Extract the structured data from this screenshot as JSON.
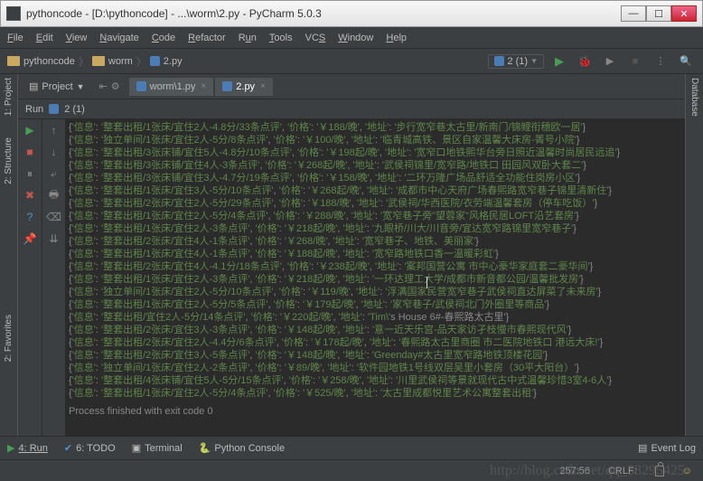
{
  "window": {
    "title": "pythoncode - [D:\\pythoncode] - ...\\worm\\2.py - PyCharm 5.0.3"
  },
  "menu": {
    "file": "File",
    "edit": "Edit",
    "view": "View",
    "navigate": "Navigate",
    "code": "Code",
    "refactor": "Refactor",
    "run": "Run",
    "tools": "Tools",
    "vcs": "VCS",
    "window": "Window",
    "help": "Help"
  },
  "breadcrumb": {
    "project": "pythoncode",
    "folder": "worm",
    "file": "2.py"
  },
  "config": {
    "label": "2 (1)"
  },
  "left_tabs": {
    "project": "1: Project",
    "structure": "2: Structure",
    "favorites": "2: Favorites"
  },
  "right_tabs": {
    "database": "Database"
  },
  "project_btn": "Project",
  "editor_tabs": [
    {
      "label": "worm\\1.py",
      "active": false
    },
    {
      "label": "2.py",
      "active": true
    }
  ],
  "run_header": "Run",
  "run_config": "2 (1)",
  "console_lines": [
    "{'信息': '整套出租/1张床/宜住2人-4.8分/33条点评', '价格': '￥188/晚', '地址': '步行宽窄巷太古里/新南门/锦鲤衔穗欧一居'}",
    "{'信息': '独立单间/1张床/宜住2人-5分/8条点评', '价格': '￥100/晚', '地址': '临青城高铁、景区自家温馨大床房-箐号小院'}",
    "{'信息': '整套出租/3张床铺/宜住5人-4.8分/10条点评', '价格': '￥198起/晚', '地址': '宽窄口地铁熙华台旁日照近温馨时尚居民远追'}",
    "{'信息': '整套出租/3张床铺/宜住4人-3条点评', '价格': '￥268起/晚', '地址': '武侯祠锦里/宽窄路/地铁口 田园风双卧大套二'}",
    "{'信息': '整套出租/3张床铺/宜住3人-4.7分/19条点评', '价格': '￥158/晚', '地址': '二环万隆广场品舒适全功能住岗房小区'}",
    "{'信息': '整套出租/1张床/宜住3人-5分/10条点评', '价格': '￥268起/晚', '地址': '成都市中心天府广场春熙路宽窄巷子锦里清新住'}",
    "{'信息': '整套出租/2张床/宜住2人-5分/29条点评', '价格': '￥188/晚', '地址': '武侯祠/华西医院/衣劳端温馨套房（停车吃饭）'}",
    "{'信息': '整套出租/1张床/宜住2人-5分/4条点评', '价格': '￥288/晚', '地址': '宽窄巷子旁\"望蓉家\"风格民居LOFT沿艺套房'}",
    "{'信息': '整套出租/1张床/宜住2人-3条点评', '价格': '￥218起/晚', '地址': '九眼桥/川大/川音旁/宜达宽窄路锦里宽窄巷子'}",
    "{'信息': '整套出租/2张床/宜住4人-1条点评', '价格': '￥268/晚', '地址': '宽窄巷子、地铁、美丽家'}",
    "{'信息': '整套出租/1张床/宜住4人-1条点评', '价格': '￥188起/晚', '地址': '宽窄路地铁口香一温暖彩虹'}",
    "{'信息': '整套出租/2张床/宜住4人-4.1分/18条点评', '价格': '￥238起/晚', '地址': '案邦国营公寓 市中心豪华家庭套二豪华间'}",
    "{'信息': '整套出租/1张床/宜住2人-3条点评', '价格': '￥218起/晚', '地址': '一环达理工大学/成都市新音都公园/温馨批发房'}",
    "{'信息': '独立单间/1张床/宜住2人-5分/10条点评', '价格': '￥119/晚', '地址': '浮满国家民营宽窄巷子武侯祠直达屏菜了未来房'}",
    "{'信息': '整套出租/1张床/宜住2人-5分/5条点评', '价格': '￥179起/晚', '地址': '家窄巷子/武侯祠北门外圈里等商品'}",
    "{'信息': '整套出租/宜住2人-5分/14条点评', '价格': '￥220起/晚', '地址': 'Tim\\'s House 6#-春熙路太古里'}",
    "{'信息': '整套出租/2张床/宜住3人-3条点评', '价格': '￥148起/晚', '地址': '意一近天乐宫-品天家访孑枝慢市春熙现代风'}",
    "{'信息': '整套出租/2张床/宜住2人-4.4分/6条点评', '价格': '￥178起/晚', '地址': '春熙路太古里商圈 市二医院地铁口 港远大床!'}",
    "{'信息': '整套出租/2张床/宜住3人-5条点评', '价格': '￥148起/晚', '地址': 'Greenday#太古里宽窄路地铁顶楼花园'}",
    "{'信息': '独立单间/1张床/宜住2人-2条点评', '价格': '￥89/晚', '地址': '软件园地铁1号线双层吴里小套房（30平大阳台）'}",
    "{'信息': '整套出租/4张床铺/宜住5人-5分/15条点评', '价格': '￥258/晚', '地址': '川里武侯祠等景就现代古中式温馨珍惜3室4-6人'}",
    "{'信息': '整套出租/1张床/宜住2人-5分/4条点评', '价格': '￥525/晚', '地址': '太古里成都悦里艺术公寓整套出租'}"
  ],
  "console_finish": "Process finished with exit code 0",
  "bottom": {
    "run": "4: Run",
    "todo": "6: TODO",
    "terminal": "Terminal",
    "python": "Python Console",
    "eventlog": "Event Log"
  },
  "status": {
    "pos": "257:56",
    "crlf": "CRLF:"
  },
  "watermark": "http://blog.csdn.net/qq_38295425"
}
